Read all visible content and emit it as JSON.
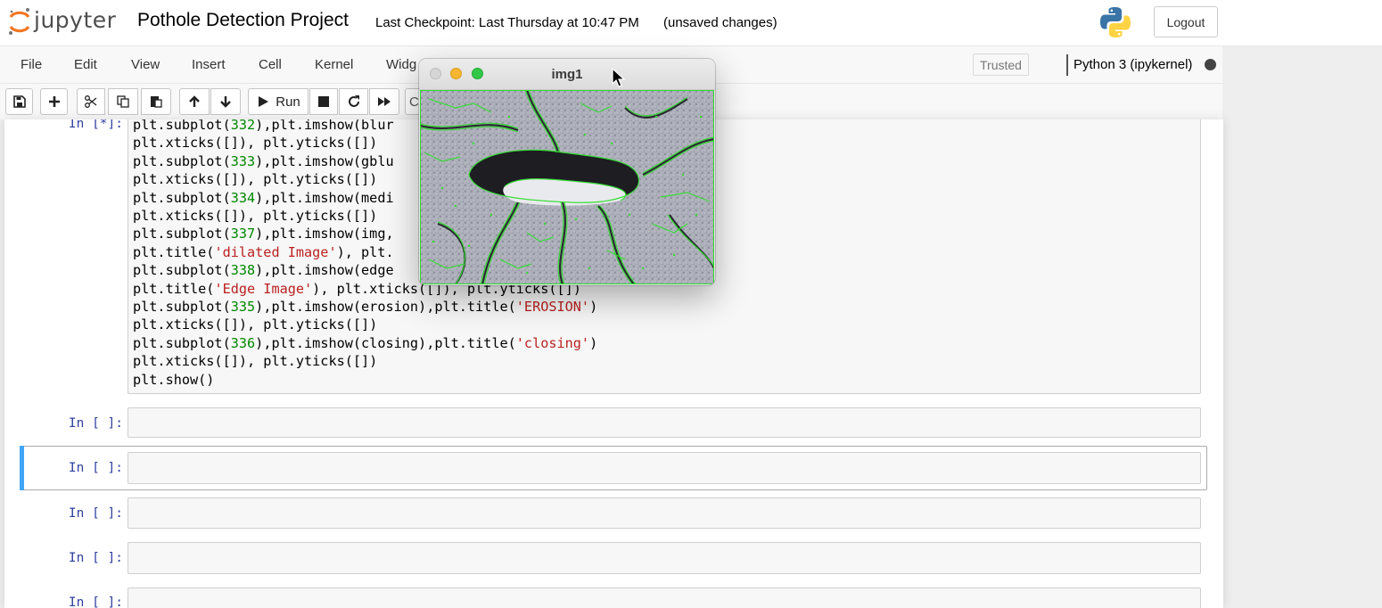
{
  "header": {
    "logo_text": "jupyter",
    "notebook_title": "Pothole Detection Project",
    "checkpoint": "Last Checkpoint: Last Thursday at 10:47 PM",
    "autosave_status": "(unsaved changes)",
    "logout_label": "Logout"
  },
  "menubar": {
    "items": [
      "File",
      "Edit",
      "View",
      "Insert",
      "Cell",
      "Kernel",
      "Widg"
    ],
    "trusted_label": "Trusted",
    "kernel_name": "Python 3 (ipykernel)"
  },
  "toolbar": {
    "run_label": "Run",
    "celltype_partial": "Co",
    "icons": [
      "save-icon",
      "plus-icon",
      "cut-icon",
      "copy-icon",
      "paste-icon",
      "arrow-up-icon",
      "arrow-down-icon",
      "play-icon",
      "stop-icon",
      "restart-icon",
      "fast-forward-icon"
    ]
  },
  "cells": {
    "running_prompt": "In [*]:",
    "empty_prompt": "In [ ]:",
    "code_lines": [
      "plt.subplot(332),plt.imshow(blur",
      "plt.xticks([]), plt.yticks([])",
      "plt.subplot(333),plt.imshow(gblu",
      "plt.xticks([]), plt.yticks([])",
      "plt.subplot(334),plt.imshow(medi",
      "plt.xticks([]), plt.yticks([])",
      "plt.subplot(337),plt.imshow(img,",
      "plt.title('dilated Image'), plt.",
      "plt.subplot(338),plt.imshow(edge",
      "plt.title('Edge Image'), plt.xticks([]), plt.yticks([])",
      "plt.subplot(335),plt.imshow(erosion),plt.title('EROSION')",
      "plt.xticks([]), plt.yticks([])",
      "plt.subplot(336),plt.imshow(closing),plt.title('closing')",
      "plt.xticks([]), plt.yticks([])",
      "plt.show()"
    ]
  },
  "image_window": {
    "title": "img1"
  },
  "colors": {
    "prompt": "#303f9f",
    "number": "#008800",
    "string": "#ba2121",
    "selected_bar": "#42a5f5",
    "edge_overlay": "#33dd33"
  }
}
